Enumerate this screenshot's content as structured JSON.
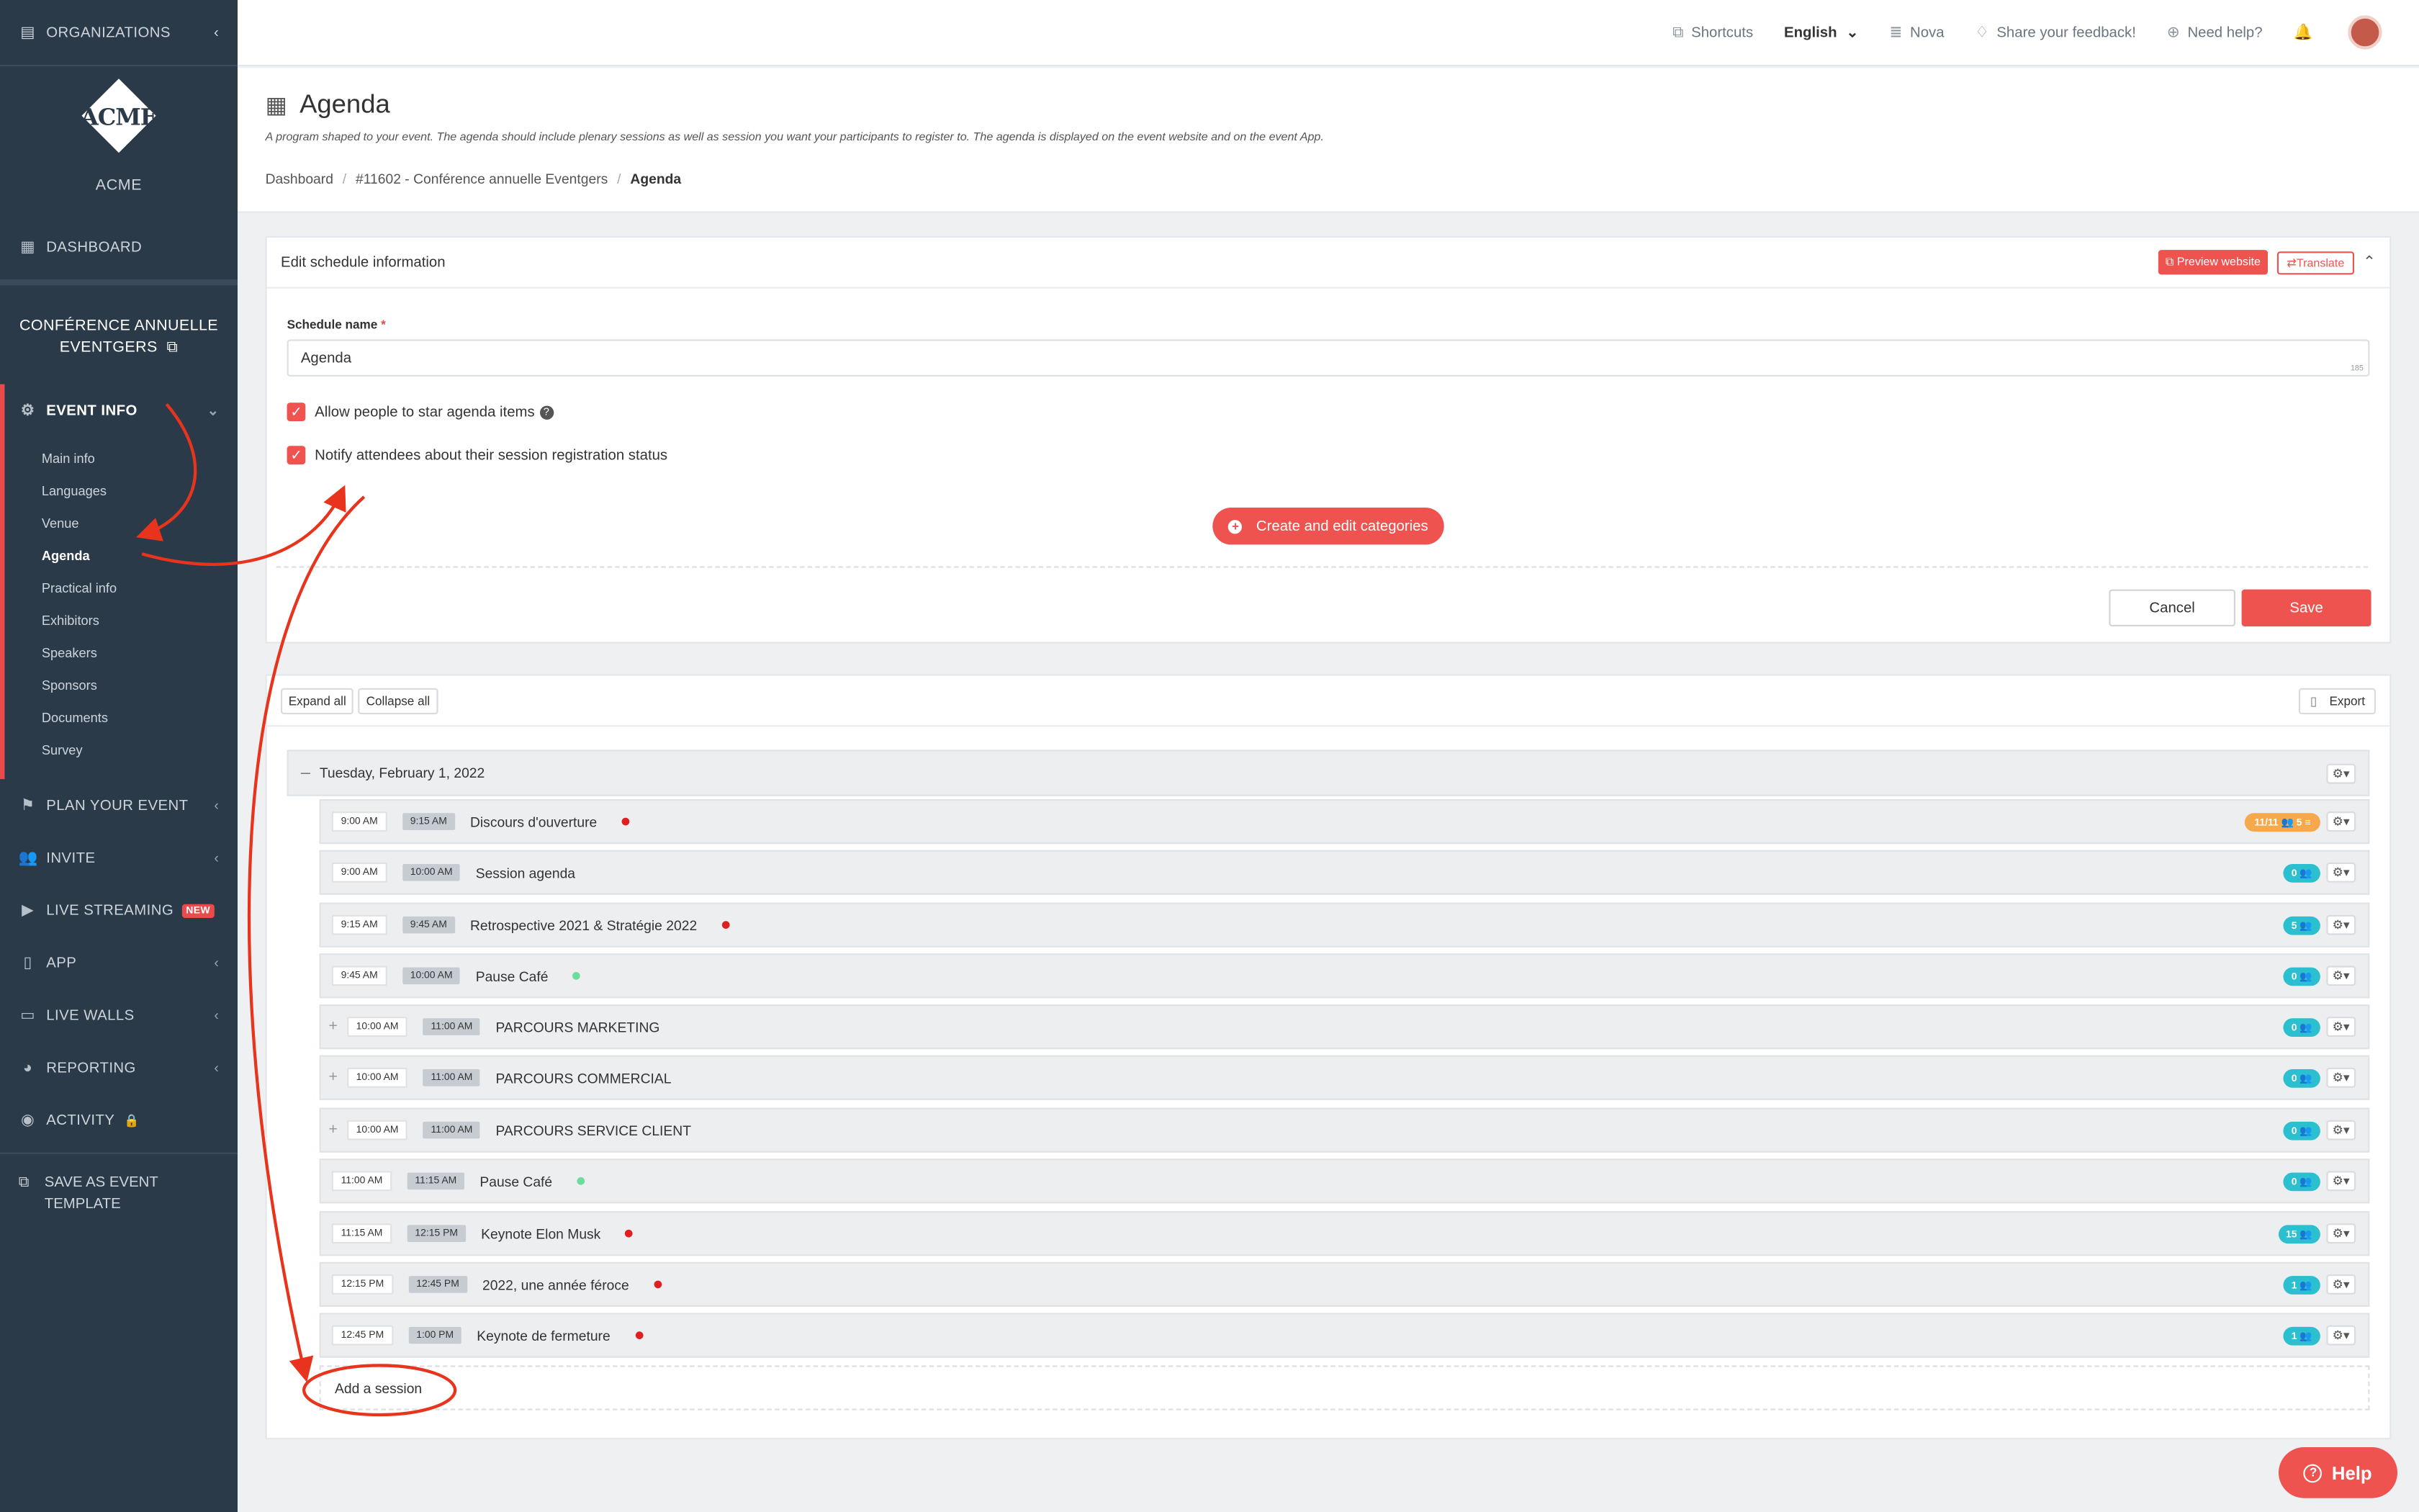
{
  "sidebar": {
    "organizations": "ORGANIZATIONS",
    "org_name": "ACME",
    "logo_text": "ACME",
    "dashboard": "DASHBOARD",
    "event_name": "CONFÉRENCE ANNUELLE EVENTGERS",
    "event_info": "EVENT INFO",
    "sub_items": [
      "Main info",
      "Languages",
      "Venue",
      "Agenda",
      "Practical info",
      "Exhibitors",
      "Speakers",
      "Sponsors",
      "Documents",
      "Survey"
    ],
    "current_sub": "Agenda",
    "plan": "PLAN YOUR EVENT",
    "invite": "INVITE",
    "live_streaming": "LIVE STREAMING",
    "new_badge": "NEW",
    "app": "APP",
    "live_walls": "LIVE WALLS",
    "reporting": "REPORTING",
    "activity": "ACTIVITY",
    "save_template": "SAVE AS EVENT TEMPLATE"
  },
  "topbar": {
    "shortcuts": "Shortcuts",
    "language": "English",
    "nova": "Nova",
    "feedback": "Share your feedback!",
    "help": "Need help?"
  },
  "header": {
    "title": "Agenda",
    "description": "A program shaped to your event. The agenda should include plenary sessions as well as session you want your participants to register to. The agenda is displayed on the event website and on the event App.",
    "breadcrumbs": [
      "Dashboard",
      "#11602 - Conférence annuelle Eventgers",
      "Agenda"
    ]
  },
  "edit_panel": {
    "title": "Edit schedule information",
    "preview": "Preview website",
    "translate": "Translate",
    "schedule_label": "Schedule name",
    "required_mark": "*",
    "schedule_value": "Agenda",
    "char_count": "185",
    "allow_star": "Allow people to star agenda items",
    "notify": "Notify attendees about their session registration status",
    "categories_btn": "Create and edit categories",
    "cancel": "Cancel",
    "save": "Save"
  },
  "agenda_panel": {
    "expand_all": "Expand all",
    "collapse_all": "Collapse all",
    "export": "Export",
    "day": "Tuesday, February 1, 2022",
    "add_session": "Add a session",
    "sessions": [
      {
        "start": "9:00 AM",
        "end": "9:15 AM",
        "title": "Discours d'ouverture",
        "dot": "red",
        "badge": "11/11",
        "badge2": "5",
        "orange": true,
        "plus": false
      },
      {
        "start": "9:00 AM",
        "end": "10:00 AM",
        "title": "Session agenda",
        "dot": "",
        "badge": "0",
        "orange": false,
        "plus": false
      },
      {
        "start": "9:15 AM",
        "end": "9:45 AM",
        "title": "Retrospective 2021 & Stratégie 2022",
        "dot": "red",
        "badge": "5",
        "orange": false,
        "plus": false
      },
      {
        "start": "9:45 AM",
        "end": "10:00 AM",
        "title": "Pause Café",
        "dot": "green",
        "badge": "0",
        "orange": false,
        "plus": false
      },
      {
        "start": "10:00 AM",
        "end": "11:00 AM",
        "title": "PARCOURS MARKETING",
        "dot": "",
        "badge": "0",
        "orange": false,
        "plus": true
      },
      {
        "start": "10:00 AM",
        "end": "11:00 AM",
        "title": "PARCOURS COMMERCIAL",
        "dot": "",
        "badge": "0",
        "orange": false,
        "plus": true
      },
      {
        "start": "10:00 AM",
        "end": "11:00 AM",
        "title": "PARCOURS SERVICE CLIENT",
        "dot": "",
        "badge": "0",
        "orange": false,
        "plus": true
      },
      {
        "start": "11:00 AM",
        "end": "11:15 AM",
        "title": "Pause Café",
        "dot": "green",
        "badge": "0",
        "orange": false,
        "plus": false
      },
      {
        "start": "11:15 AM",
        "end": "12:15 PM",
        "title": "Keynote Elon Musk",
        "dot": "red",
        "badge": "15",
        "orange": false,
        "plus": false
      },
      {
        "start": "12:15 PM",
        "end": "12:45 PM",
        "title": "2022, une année féroce",
        "dot": "red",
        "badge": "1",
        "orange": false,
        "plus": false
      },
      {
        "start": "12:45 PM",
        "end": "1:00 PM",
        "title": "Keynote de fermeture",
        "dot": "red",
        "badge": "1",
        "orange": false,
        "plus": false
      }
    ]
  },
  "help_button": "Help",
  "colors": {
    "accent": "#ef5350",
    "sidebar": "#2b3a49",
    "cyan_badge": "#2bbfcf",
    "orange_badge": "#f5a94b",
    "annotation": "#e8341c"
  }
}
